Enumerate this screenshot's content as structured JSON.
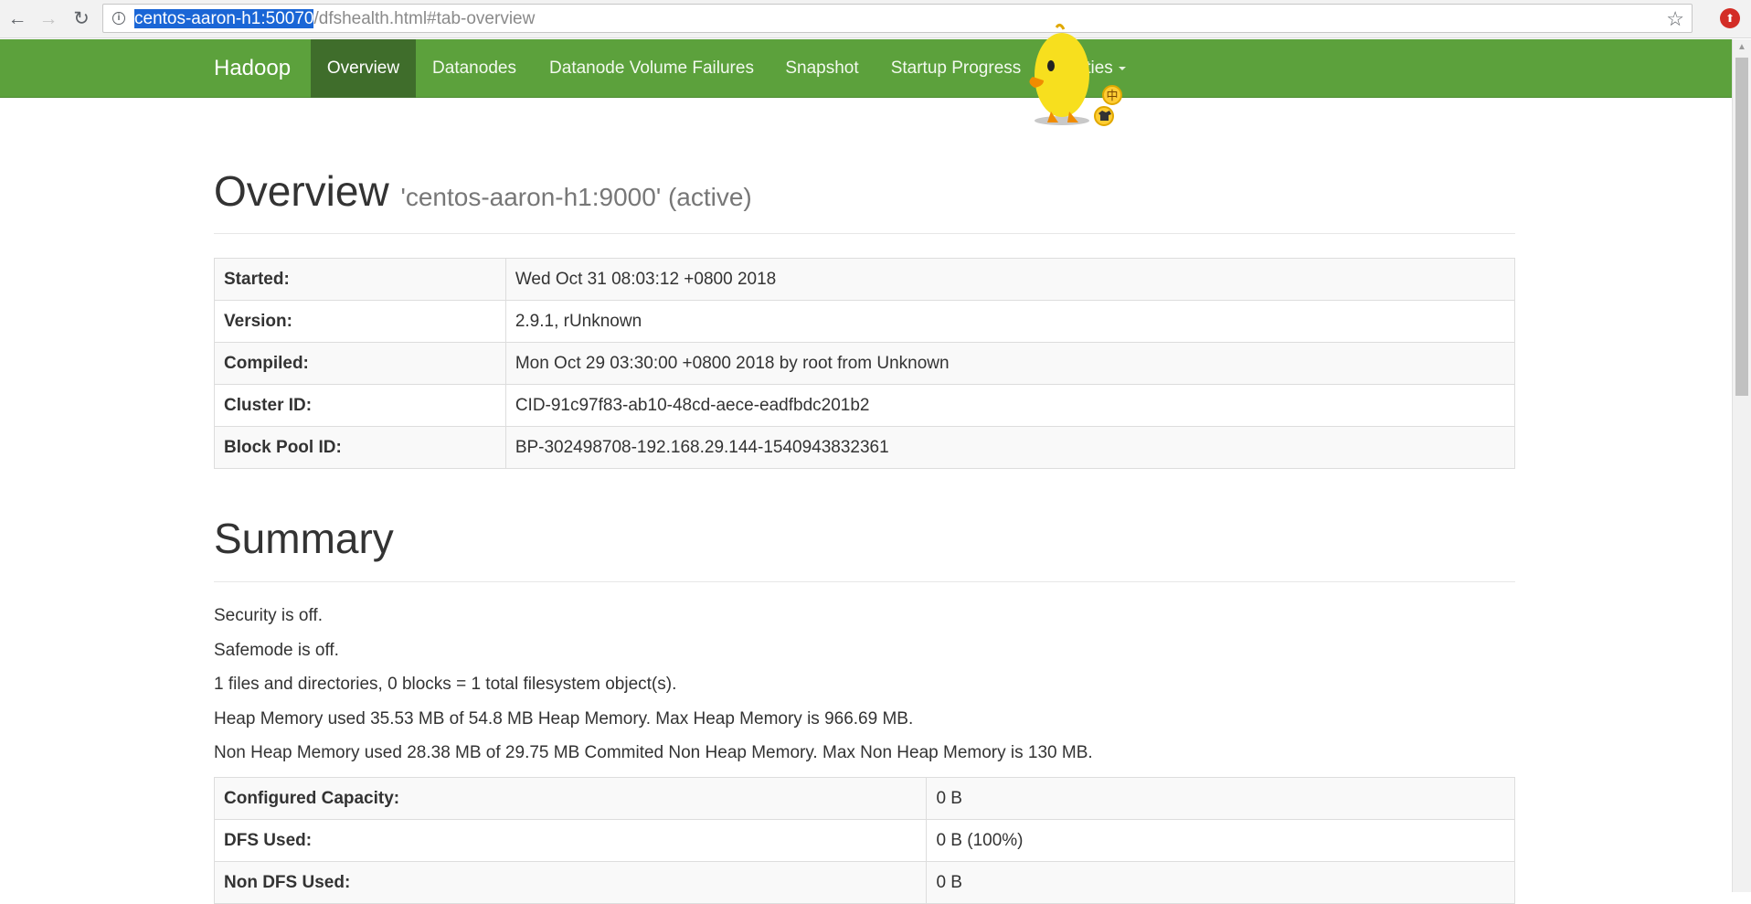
{
  "browser": {
    "url_host": "centos-aaron-h1:50070",
    "url_path": "/dfshealth.html#tab-overview",
    "back_icon": "←",
    "forward_icon": "→",
    "reload_icon": "↻",
    "star_icon": "☆"
  },
  "navbar": {
    "brand": "Hadoop",
    "items": [
      {
        "label": "Overview",
        "active": true
      },
      {
        "label": "Datanodes"
      },
      {
        "label": "Datanode Volume Failures"
      },
      {
        "label": "Snapshot"
      },
      {
        "label": "Startup Progress"
      },
      {
        "label": "ties"
      }
    ]
  },
  "overview": {
    "title": "Overview",
    "subtitle": "'centos-aaron-h1:9000' (active)",
    "rows": [
      {
        "key": "Started:",
        "value": "Wed Oct 31 08:03:12 +0800 2018"
      },
      {
        "key": "Version:",
        "value": "2.9.1, rUnknown"
      },
      {
        "key": "Compiled:",
        "value": "Mon Oct 29 03:30:00 +0800 2018 by root from Unknown"
      },
      {
        "key": "Cluster ID:",
        "value": "CID-91c97f83-ab10-48cd-aece-eadfbdc201b2"
      },
      {
        "key": "Block Pool ID:",
        "value": "BP-302498708-192.168.29.144-1540943832361"
      }
    ]
  },
  "summary": {
    "title": "Summary",
    "lines": [
      "Security is off.",
      "Safemode is off.",
      "1 files and directories, 0 blocks = 1 total filesystem object(s).",
      "Heap Memory used 35.53 MB of 54.8 MB Heap Memory. Max Heap Memory is 966.69 MB.",
      "Non Heap Memory used 28.38 MB of 29.75 MB Commited Non Heap Memory. Max Non Heap Memory is 130 MB."
    ],
    "rows": [
      {
        "key": "Configured Capacity:",
        "value": "0 B"
      },
      {
        "key": "DFS Used:",
        "value": "0 B (100%)"
      },
      {
        "key": "Non DFS Used:",
        "value": "0 B"
      }
    ]
  }
}
